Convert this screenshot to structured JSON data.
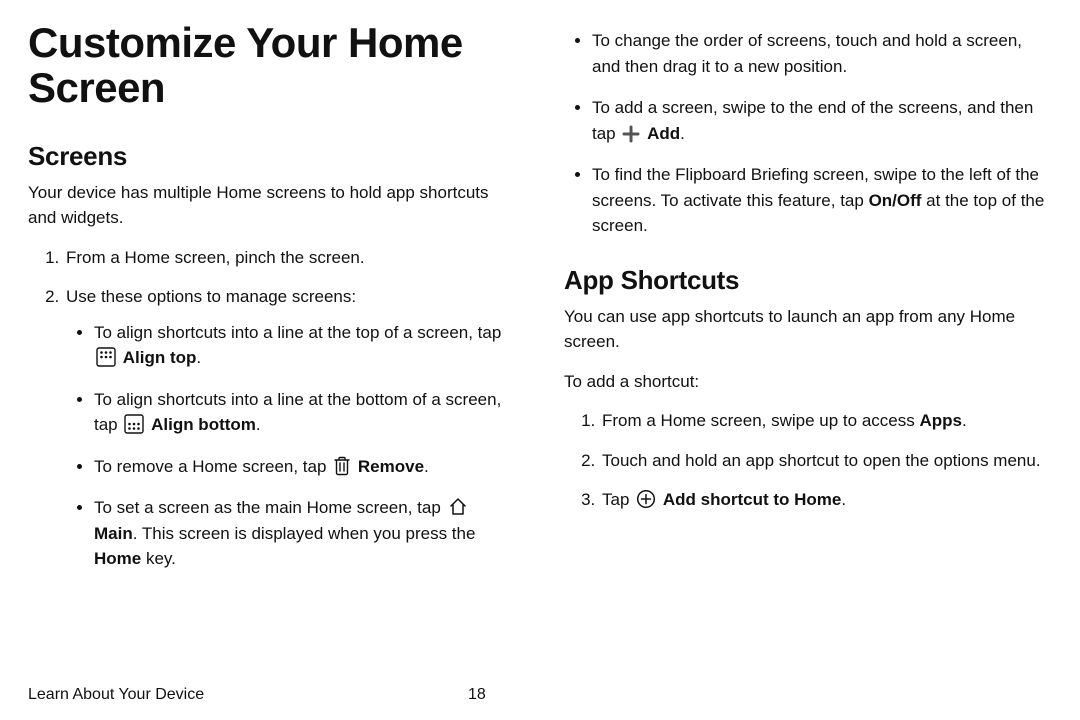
{
  "title": "Customize Your Home Screen",
  "left": {
    "screens_heading": "Screens",
    "screens_intro": "Your device has multiple Home screens to hold app shortcuts and widgets.",
    "step1": "From a Home screen, pinch the screen.",
    "step2": "Use these options to manage screens:",
    "b1_a": "To align shortcuts into a line at the top of a screen, tap ",
    "b1_bold": "Align top",
    "b1_b": ".",
    "b2_a": "To align shortcuts into a line at the bottom of a screen, tap ",
    "b2_bold": "Align bottom",
    "b2_b": ".",
    "b3_a": "To remove a Home screen, tap ",
    "b3_bold": "Remove",
    "b3_b": ".",
    "b4_a": "To set a screen as the main Home screen, tap ",
    "b4_bold": "Main",
    "b4_b": ". This screen is displayed when you press the ",
    "b4_bold2": "Home",
    "b4_c": " key."
  },
  "right": {
    "top_b1": "To change the order of screens, touch and hold a screen, and then drag it to a new position.",
    "top_b2_a": "To add a screen, swipe to the end of the screens, and then tap ",
    "top_b2_bold": "Add",
    "top_b2_b": ".",
    "top_b3_a": "To find the Flipboard Briefing screen, swipe to the left of the screens. To activate this feature, tap ",
    "top_b3_bold": "On/Off",
    "top_b3_b": " at the top of the screen.",
    "apps_heading": "App Shortcuts",
    "apps_intro": "You can use app shortcuts to launch an app from any Home screen.",
    "apps_lead": "To add a shortcut:",
    "apps_s1_a": "From a Home screen, swipe up to access ",
    "apps_s1_bold": "Apps",
    "apps_s1_b": ".",
    "apps_s2": "Touch and hold an app shortcut to open the options menu.",
    "apps_s3_a": "Tap ",
    "apps_s3_bold": "Add shortcut to Home",
    "apps_s3_b": "."
  },
  "footer": {
    "section": "Learn About Your Device",
    "page": "18"
  }
}
